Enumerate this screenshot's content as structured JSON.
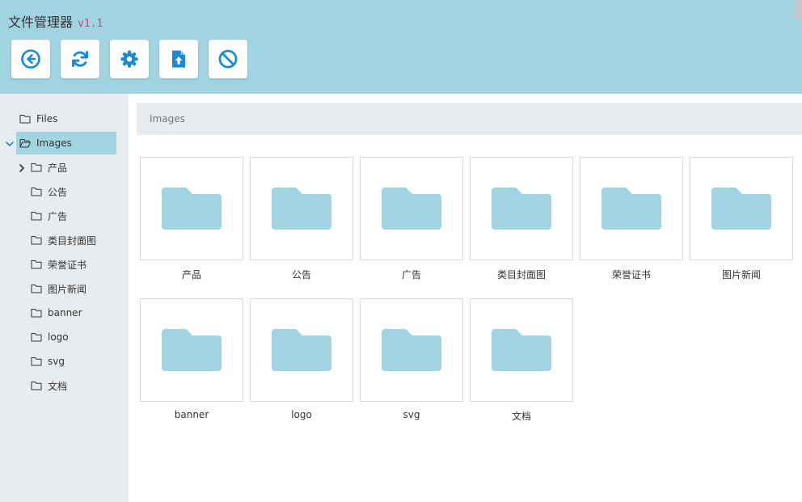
{
  "app": {
    "title": "文件管理器",
    "version": "v1.1"
  },
  "toolbar": [
    {
      "name": "back-button",
      "icon": "circle-arrow-left-icon"
    },
    {
      "name": "refresh-button",
      "icon": "refresh-icon"
    },
    {
      "name": "settings-button",
      "icon": "gear-icon"
    },
    {
      "name": "upload-button",
      "icon": "file-upload-icon"
    },
    {
      "name": "cancel-button",
      "icon": "ban-icon"
    }
  ],
  "sidebar": {
    "root": {
      "label": "Files"
    },
    "current": {
      "label": "Images",
      "expanded": true
    },
    "children": [
      {
        "label": "产品",
        "has_children": true
      },
      {
        "label": "公告"
      },
      {
        "label": "广告"
      },
      {
        "label": "类目封面图"
      },
      {
        "label": "荣誉证书"
      },
      {
        "label": "图片新闻"
      },
      {
        "label": "banner"
      },
      {
        "label": "logo"
      },
      {
        "label": "svg"
      },
      {
        "label": "文档"
      }
    ]
  },
  "breadcrumb": {
    "path": "Images"
  },
  "folders": [
    {
      "label": "产品"
    },
    {
      "label": "公告"
    },
    {
      "label": "广告"
    },
    {
      "label": "类目封面图"
    },
    {
      "label": "荣誉证书"
    },
    {
      "label": "图片新闻"
    },
    {
      "label": "banner"
    },
    {
      "label": "logo"
    },
    {
      "label": "svg"
    },
    {
      "label": "文档"
    }
  ],
  "colors": {
    "header": "#a0d4e0",
    "accent_icon": "#1a8ad6",
    "folder": "#a0d4e0",
    "sidebar_bg": "#e9ecef",
    "active_item": "#a0d4e0",
    "version_text": "#c0457a"
  }
}
